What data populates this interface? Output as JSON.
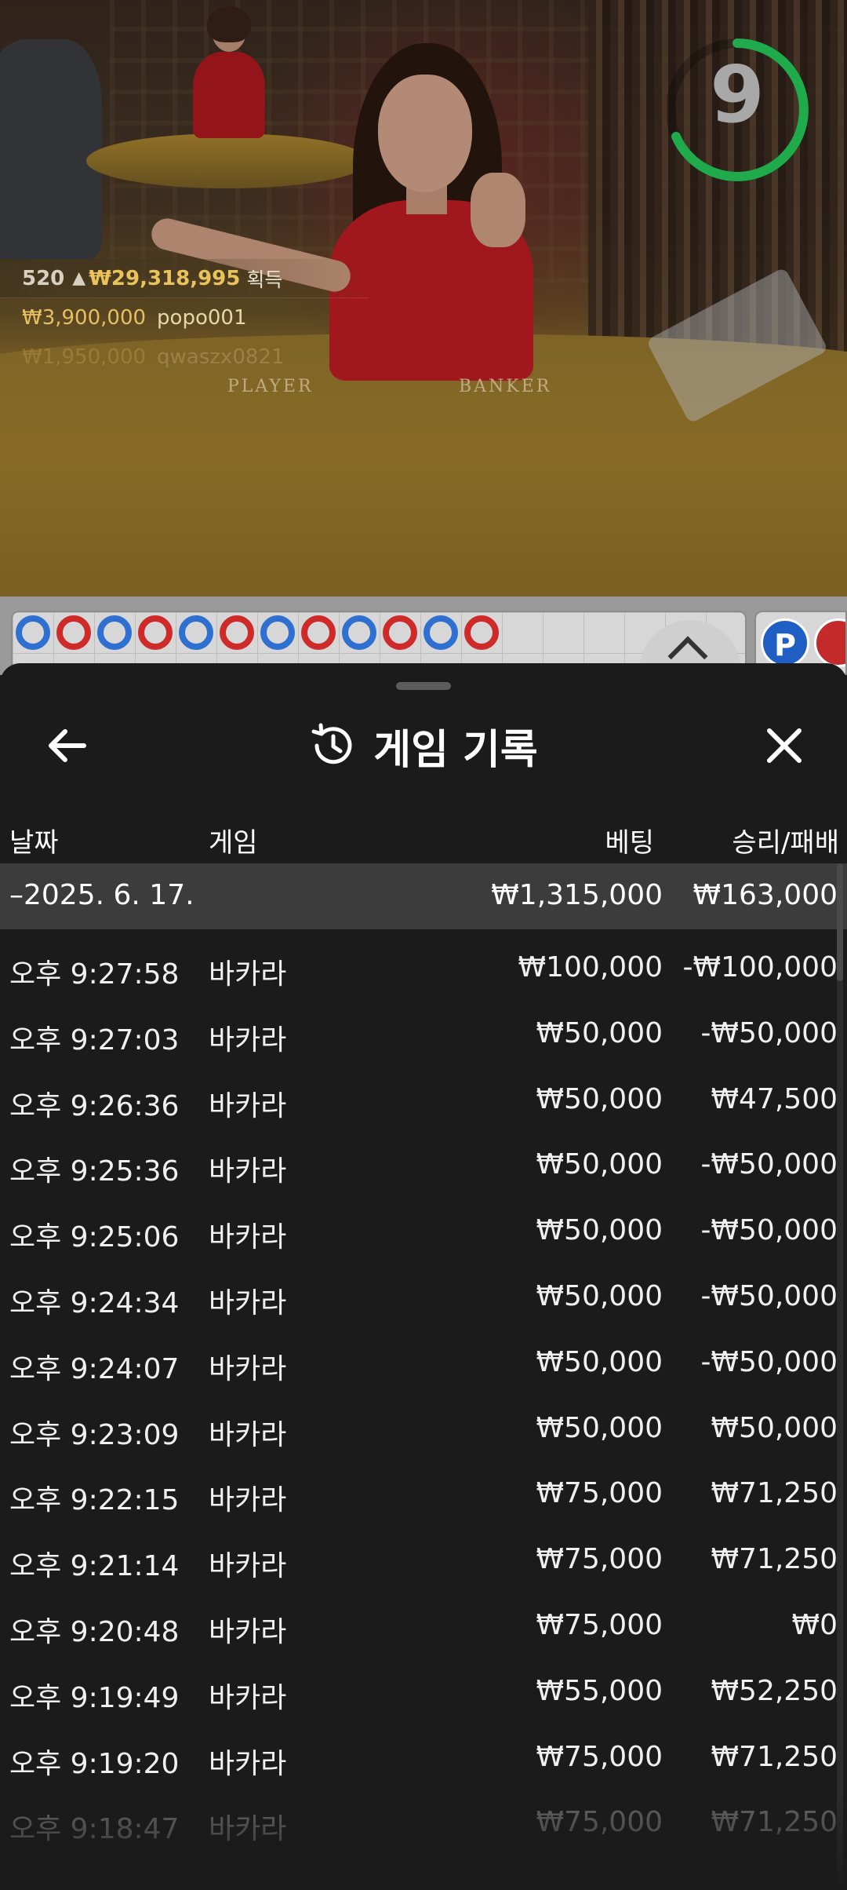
{
  "video": {
    "timer": "9",
    "felt_labels": {
      "player": "PLAYER",
      "banker": "BANKER"
    },
    "winners": {
      "count": "520",
      "total": "₩29,318,995",
      "total_suffix": "획득",
      "top_amount": "₩3,900,000",
      "top_user": "popo001",
      "next_amount": "₩1,950,000",
      "next_user": "qwaszx0821"
    }
  },
  "roadmap": {
    "beads": [
      "b",
      "r",
      "b",
      "r",
      "b",
      "r",
      "b",
      "r",
      "b",
      "r",
      "b",
      "r"
    ],
    "predict_label": "P"
  },
  "sheet": {
    "title": "게임 기록",
    "columns": {
      "date": "날짜",
      "game": "게임",
      "bet": "베팅",
      "winloss": "승리/패배"
    },
    "group": {
      "date": "–2025. 6. 17.",
      "bet": "₩1,315,000",
      "winloss": "₩163,000"
    },
    "rows": [
      {
        "time": "오후 9:27:58",
        "game": "바카라",
        "bet": "₩100,000",
        "winloss": "-₩100,000"
      },
      {
        "time": "오후 9:27:03",
        "game": "바카라",
        "bet": "₩50,000",
        "winloss": "-₩50,000"
      },
      {
        "time": "오후 9:26:36",
        "game": "바카라",
        "bet": "₩50,000",
        "winloss": "₩47,500"
      },
      {
        "time": "오후 9:25:36",
        "game": "바카라",
        "bet": "₩50,000",
        "winloss": "-₩50,000"
      },
      {
        "time": "오후 9:25:06",
        "game": "바카라",
        "bet": "₩50,000",
        "winloss": "-₩50,000"
      },
      {
        "time": "오후 9:24:34",
        "game": "바카라",
        "bet": "₩50,000",
        "winloss": "-₩50,000"
      },
      {
        "time": "오후 9:24:07",
        "game": "바카라",
        "bet": "₩50,000",
        "winloss": "-₩50,000"
      },
      {
        "time": "오후 9:23:09",
        "game": "바카라",
        "bet": "₩50,000",
        "winloss": "₩50,000"
      },
      {
        "time": "오후 9:22:15",
        "game": "바카라",
        "bet": "₩75,000",
        "winloss": "₩71,250"
      },
      {
        "time": "오후 9:21:14",
        "game": "바카라",
        "bet": "₩75,000",
        "winloss": "₩71,250"
      },
      {
        "time": "오후 9:20:48",
        "game": "바카라",
        "bet": "₩75,000",
        "winloss": "₩0"
      },
      {
        "time": "오후 9:19:49",
        "game": "바카라",
        "bet": "₩55,000",
        "winloss": "₩52,250"
      },
      {
        "time": "오후 9:19:20",
        "game": "바카라",
        "bet": "₩75,000",
        "winloss": "₩71,250"
      },
      {
        "time": "오후 9:18:47",
        "game": "바카라",
        "bet": "₩75,000",
        "winloss": "₩71,250"
      }
    ]
  },
  "colors": {
    "sheet_bg": "#1b1b1b",
    "group_row_bg": "#3c3c3c",
    "timer_ring": "#1faa4c",
    "winner_gold": "#e8c25a",
    "bead_blue": "#2e6fd0",
    "bead_red": "#cf2a2a"
  },
  "icons": {
    "back": "arrow-left-icon",
    "history": "history-clock-icon",
    "close": "close-x-icon",
    "roadmap_toggle": "chevron-up-icon",
    "winner": "person-icon"
  }
}
